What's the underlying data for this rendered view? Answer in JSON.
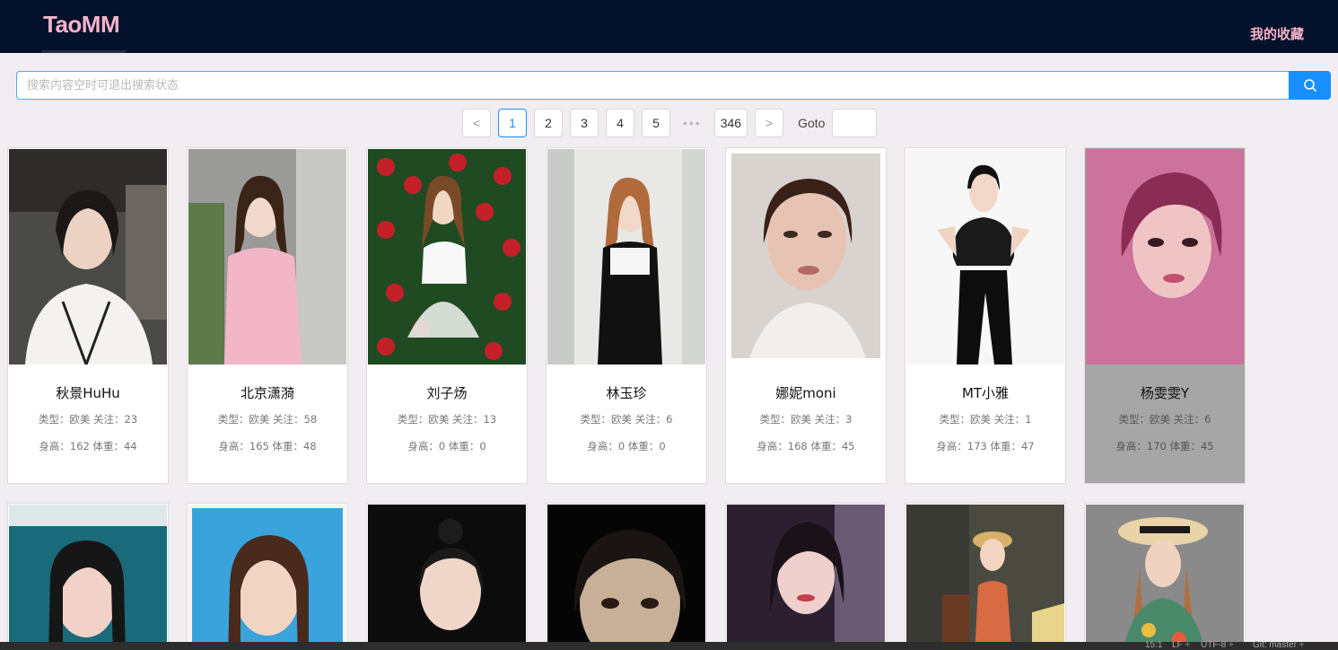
{
  "header": {
    "logo": "TaoMM",
    "favorites_link": "我的收藏"
  },
  "search": {
    "placeholder": "搜索内容空时可退出搜索状态"
  },
  "pagination": {
    "prev": "<",
    "next": ">",
    "pages": [
      "1",
      "2",
      "3",
      "4",
      "5"
    ],
    "current": "1",
    "ellipsis": "•••",
    "last": "346",
    "goto_label": "Goto"
  },
  "cards": [
    {
      "name": "秋景HuHu",
      "line1": "类型：欧美 关注：23",
      "line2": "身高：162 体重：44"
    },
    {
      "name": "北京潇漪",
      "line1": "类型：欧美 关注：58",
      "line2": "身高：165 体重：48"
    },
    {
      "name": "刘子炀",
      "line1": "类型：欧美 关注：13",
      "line2": "身高：0 体重：0"
    },
    {
      "name": "林玉珍",
      "line1": "类型：欧美 关注：6",
      "line2": "身高：0 体重：0"
    },
    {
      "name": "娜妮moni",
      "line1": "类型：欧美 关注：3",
      "line2": "身高：168 体重：45"
    },
    {
      "name": "MT小雅",
      "line1": "类型：欧美 关注：1",
      "line2": "身高：173 体重：47"
    },
    {
      "name": "杨雯雯Y",
      "line1": "类型：欧美 关注：6",
      "line2": "身高：170 体重：45"
    }
  ],
  "statusbar": {
    "pos": "15:1",
    "eol": "LF ÷",
    "enc": "UTF-8 ÷",
    "git": "Git: master ÷"
  }
}
